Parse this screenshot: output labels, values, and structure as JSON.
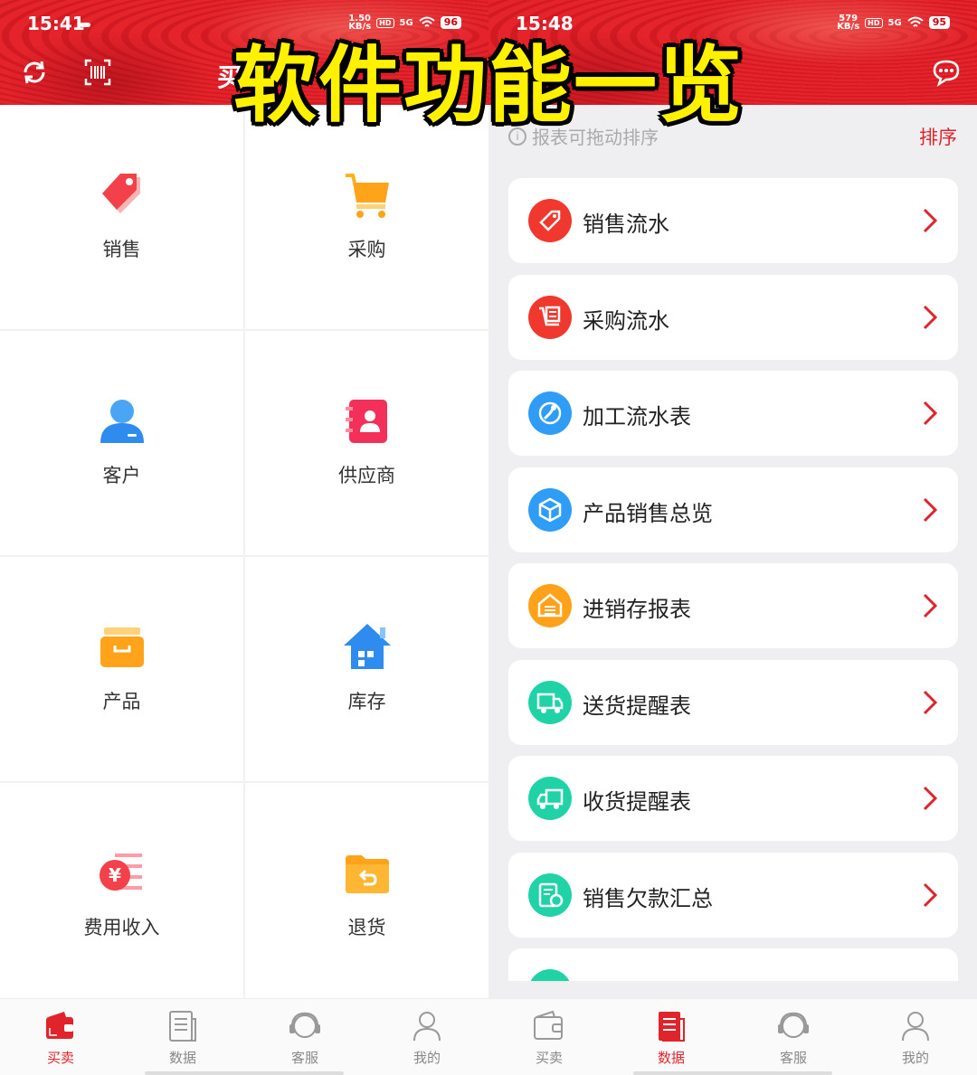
{
  "overlay_title": "软件功能一览",
  "left": {
    "status": {
      "time": "15:41",
      "speed_top": "1.50",
      "speed_bottom": "KB/s",
      "hd": "HD",
      "net": "5G",
      "battery": "96"
    },
    "header_fragment": "买",
    "grid": [
      {
        "label": "销售",
        "icon": "price-tag-icon"
      },
      {
        "label": "采购",
        "icon": "shopping-cart-icon"
      },
      {
        "label": "客户",
        "icon": "customer-person-icon"
      },
      {
        "label": "供应商",
        "icon": "supplier-contact-book-icon"
      },
      {
        "label": "产品",
        "icon": "product-box-icon"
      },
      {
        "label": "库存",
        "icon": "warehouse-house-icon"
      },
      {
        "label": "费用收入",
        "icon": "yen-coin-icon"
      },
      {
        "label": "退货",
        "icon": "return-folder-icon"
      }
    ],
    "tabs": [
      {
        "label": "买卖",
        "icon": "wallet-icon",
        "active": true
      },
      {
        "label": "数据",
        "icon": "report-icon",
        "active": false
      },
      {
        "label": "客服",
        "icon": "headset-icon",
        "active": false
      },
      {
        "label": "我的",
        "icon": "user-icon",
        "active": false
      }
    ]
  },
  "right": {
    "status": {
      "time": "15:48",
      "speed_top": "579",
      "speed_bottom": "KB/s",
      "hd": "HD",
      "net": "5G",
      "battery": "95"
    },
    "tip": "报表可拖动排序",
    "sort_label": "排序",
    "reports": [
      {
        "label": "销售流水",
        "icon": "tag-icon",
        "color": "#f0382e"
      },
      {
        "label": "采购流水",
        "icon": "cart-receipt-icon",
        "color": "#f0382e"
      },
      {
        "label": "加工流水表",
        "icon": "wrench-icon",
        "color": "#2f9df5"
      },
      {
        "label": "产品销售总览",
        "icon": "cube-icon",
        "color": "#2f9df5"
      },
      {
        "label": "进销存报表",
        "icon": "warehouse-icon",
        "color": "#ffa21a"
      },
      {
        "label": "送货提醒表",
        "icon": "delivery-truck-icon",
        "color": "#20d3a6"
      },
      {
        "label": "收货提醒表",
        "icon": "receive-truck-icon",
        "color": "#20d3a6"
      },
      {
        "label": "销售欠款汇总",
        "icon": "debt-document-icon",
        "color": "#20d3a6"
      }
    ],
    "tabs": [
      {
        "label": "买卖",
        "icon": "wallet-icon",
        "active": false
      },
      {
        "label": "数据",
        "icon": "report-icon",
        "active": true
      },
      {
        "label": "客服",
        "icon": "headset-icon",
        "active": false
      },
      {
        "label": "我的",
        "icon": "user-icon",
        "active": false
      }
    ]
  },
  "colors": {
    "brand_red": "#dd1f26",
    "accent_yellow": "#fff100",
    "tab_active": "#e0242c"
  }
}
